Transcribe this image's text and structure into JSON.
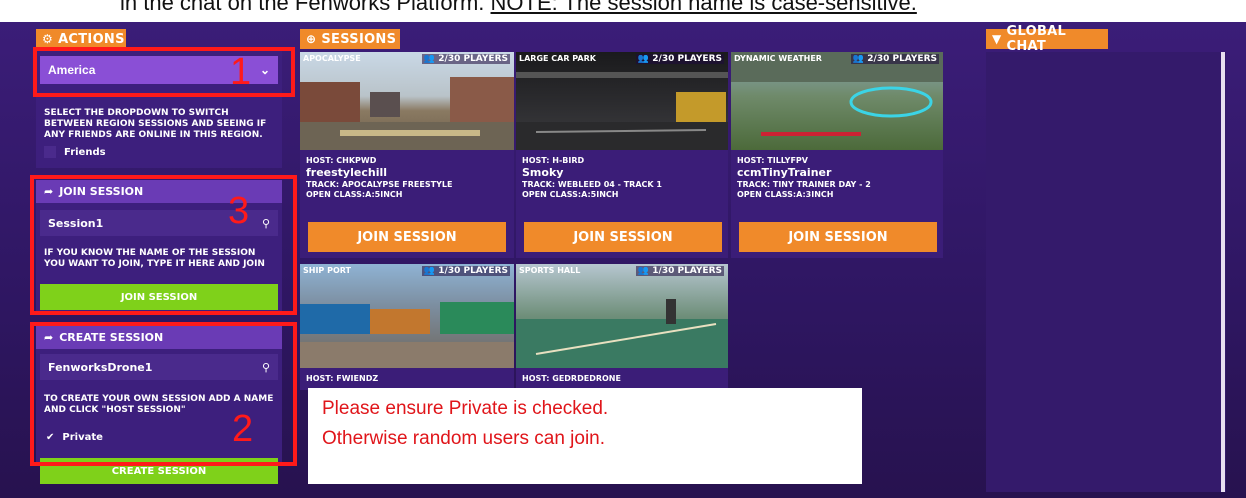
{
  "header_text": {
    "prefix": "in the chat on the Fenworks Platform. ",
    "note": "NOTE: The session name is case-sensitive."
  },
  "actions": {
    "title": "ACTIONS",
    "region_value": "America",
    "region_help": "SELECT THE DROPDOWN TO SWITCH BETWEEN REGION SESSIONS AND SEEING IF ANY FRIENDS ARE ONLINE IN THIS REGION.",
    "friends_label": "Friends"
  },
  "join": {
    "title": "JOIN SESSION",
    "input_value": "Session1",
    "help": "IF YOU KNOW THE NAME OF THE SESSION YOU WANT TO JOIN, TYPE IT HERE AND JOIN",
    "button": "JOIN SESSION"
  },
  "create": {
    "title": "CREATE SESSION",
    "input_value": "FenworksDrone1",
    "help": "TO CREATE YOUR OWN SESSION ADD A NAME AND CLICK \"HOST SESSION\"",
    "private_label": "Private",
    "button": "CREATE SESSION"
  },
  "annotations": {
    "n1": "1",
    "n2": "2",
    "n3": "3"
  },
  "sessions_title": "SESSIONS",
  "sessions": [
    {
      "map": "APOCALYPSE",
      "players": "2/30 PLAYERS",
      "host": "HOST: CHKPWD",
      "name": "freestylechill",
      "track": "TRACK: APOCALYPSE FREESTYLE",
      "cls": "OPEN CLASS:A:5INCH",
      "button": "JOIN SESSION"
    },
    {
      "map": "LARGE CAR PARK",
      "players": "2/30 PLAYERS",
      "host": "HOST: H-BIRD",
      "name": "Smoky",
      "track": "TRACK: WEBLEED 04 - TRACK 1",
      "cls": "OPEN CLASS:A:5INCH",
      "button": "JOIN SESSION"
    },
    {
      "map": "DYNAMIC WEATHER",
      "players": "2/30 PLAYERS",
      "host": "HOST: TILLYFPV",
      "name": "ccmTinyTrainer",
      "track": "TRACK: TINY TRAINER DAY - 2",
      "cls": "OPEN CLASS:A:3INCH",
      "button": "JOIN SESSION"
    },
    {
      "map": "SHIP PORT",
      "players": "1/30 PLAYERS",
      "host": "HOST: FWIENDZ"
    },
    {
      "map": "SPORTS HALL",
      "players": "1/30 PLAYERS",
      "host": "HOST: GEDRDEDRONE"
    }
  ],
  "chat_title": "GLOBAL CHAT",
  "notice": {
    "line1": "Please ensure Private is checked.",
    "line2": "Otherwise random users can join."
  },
  "colors": {
    "accent_orange": "#f08a2a",
    "accent_green": "#7fd11a",
    "annotation_red": "#ff1a1a",
    "bg_purple": "#2a1453"
  }
}
